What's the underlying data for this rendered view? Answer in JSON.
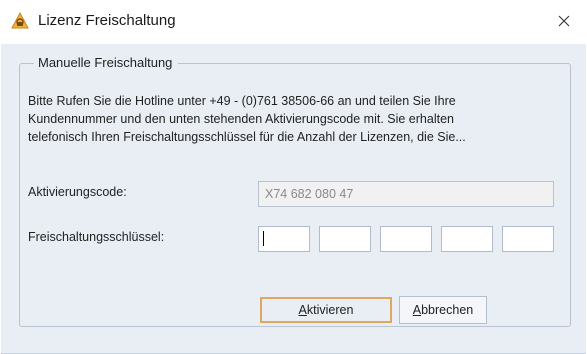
{
  "window": {
    "title": "Lizenz Freischaltung",
    "icon": "warning-key-icon",
    "close_symbol": "✕"
  },
  "group": {
    "title": "Manuelle Freischaltung",
    "message_lines": [
      "Bitte Rufen Sie die Hotline unter +49 - (0)761 38506-66 an und teilen Sie Ihre",
      "Kundennummer und den unten stehenden Aktivierungscode mit. Sie erhalten",
      "telefonisch Ihren Freischaltungsschlüssel für die Anzahl der Lizenzen, die Sie..."
    ]
  },
  "activation_code": {
    "label": "Aktivierungscode:",
    "value": "X74 682 080 47"
  },
  "unlock_key": {
    "label": "Freischaltungsschlüssel:",
    "segments": [
      "",
      "",
      "",
      "",
      ""
    ]
  },
  "buttons": {
    "activate": {
      "mnemonic": "A",
      "rest": "ktivieren"
    },
    "cancel": {
      "mnemonic": "A",
      "rest": "bbrechen"
    }
  },
  "colors": {
    "dialog_background": "#e9eef5",
    "default_button_border": "#e0a75e",
    "icon_orange": "#f0a830"
  }
}
